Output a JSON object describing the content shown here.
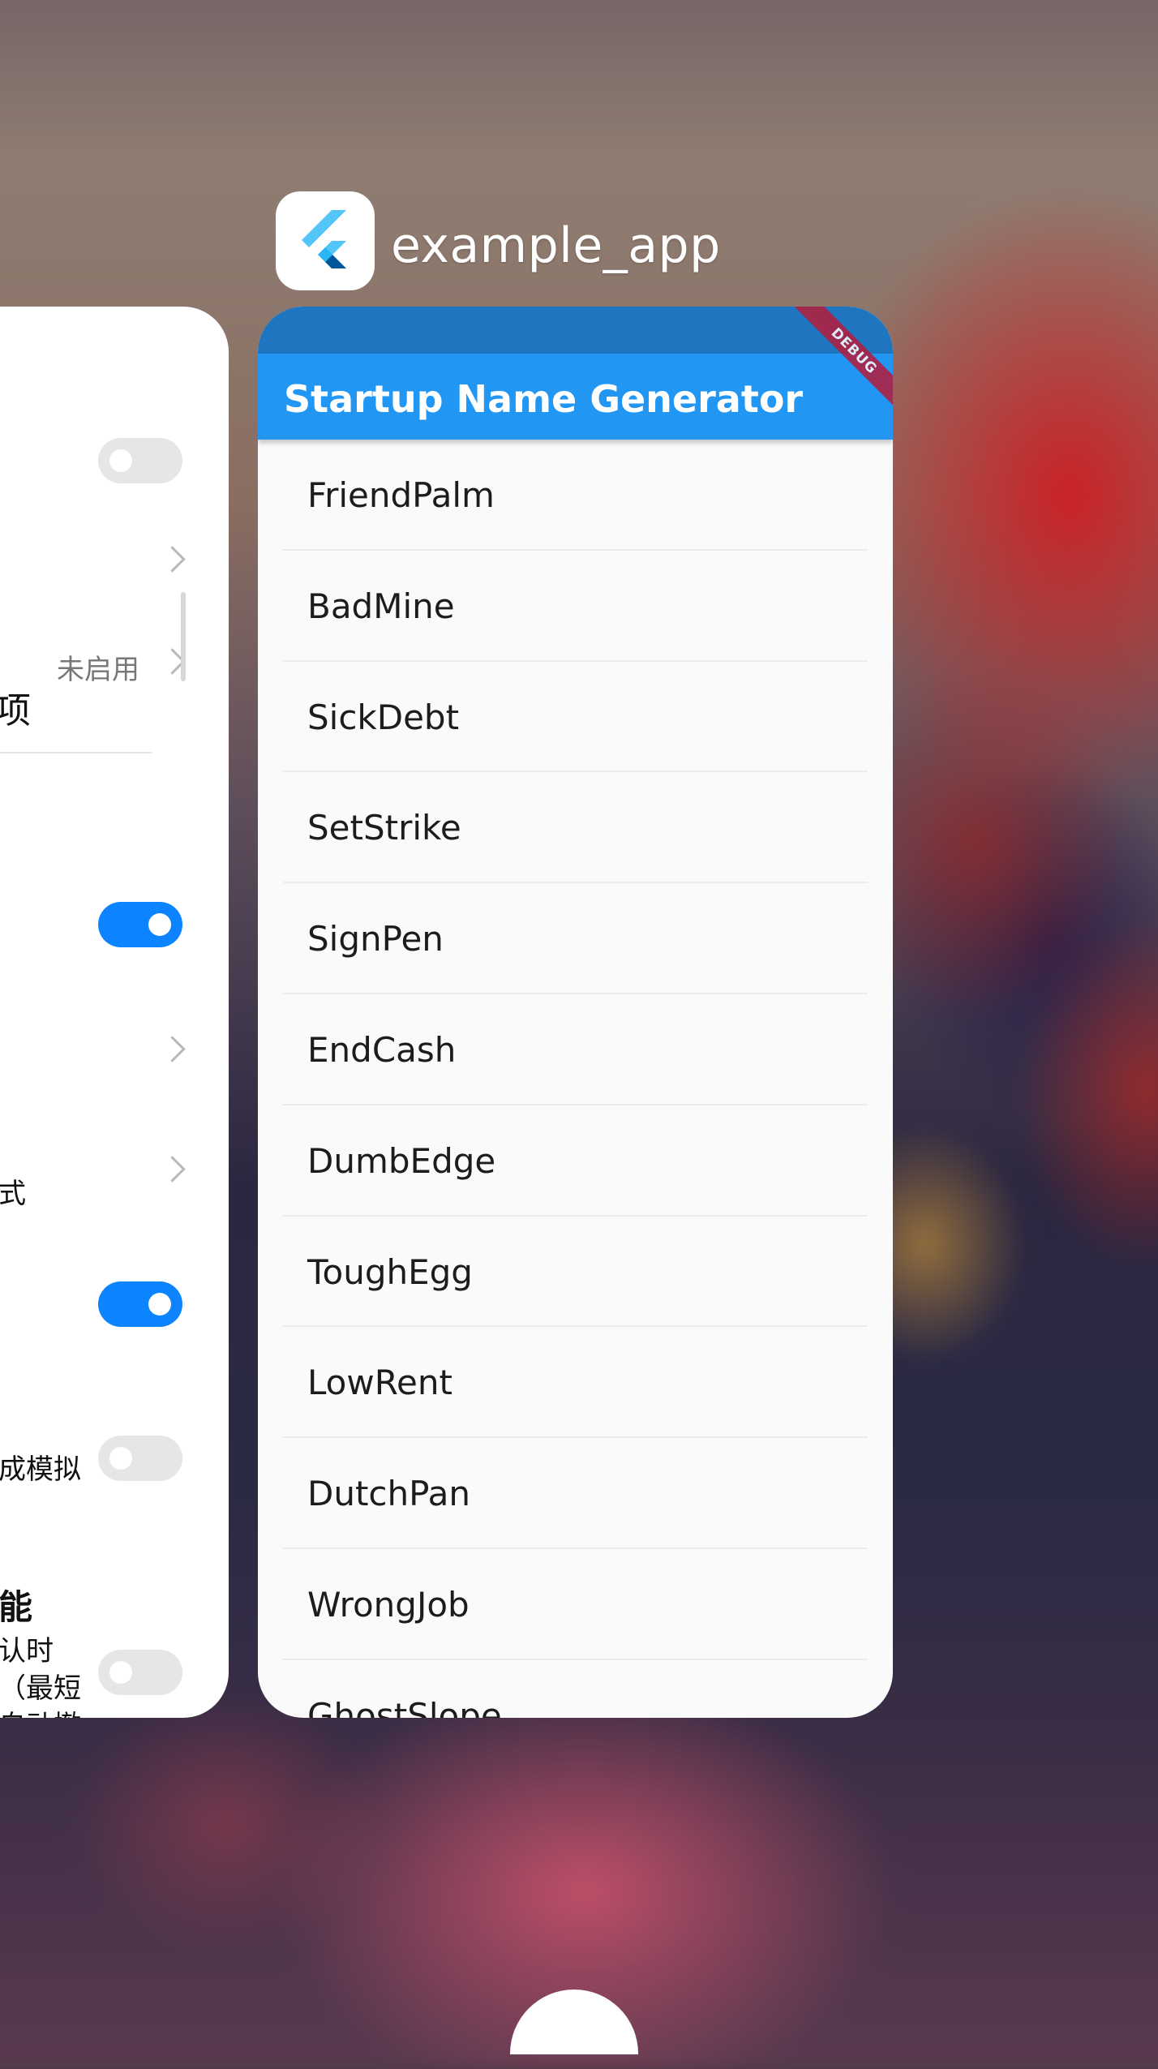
{
  "recents": {
    "app_name": "example_app",
    "app_icon": "flutter-logo-icon"
  },
  "left_card": {
    "title_fragment": "项",
    "unset_label": "未启用",
    "row_fragment_1": "式",
    "row_fragment_2": "成模拟",
    "section_fragment": "能",
    "desc_line_1": "认时",
    "desc_line_2": "（最短",
    "desc_line_3": "自动撤",
    "toggle_states": [
      "off",
      "on",
      "on",
      "off",
      "off"
    ]
  },
  "app": {
    "title": "Startup Name Generator",
    "debug_banner": "DEBUG",
    "colors": {
      "appbar": "#2196f3",
      "statusbar": "#1f75bf",
      "debug_banner": "#b71c3a"
    },
    "items": [
      "FriendPalm",
      "BadMine",
      "SickDebt",
      "SetStrike",
      "SignPen",
      "EndCash",
      "DumbEdge",
      "ToughEgg",
      "LowRent",
      "DutchPan",
      "WrongJob",
      "GhostSlope"
    ]
  }
}
